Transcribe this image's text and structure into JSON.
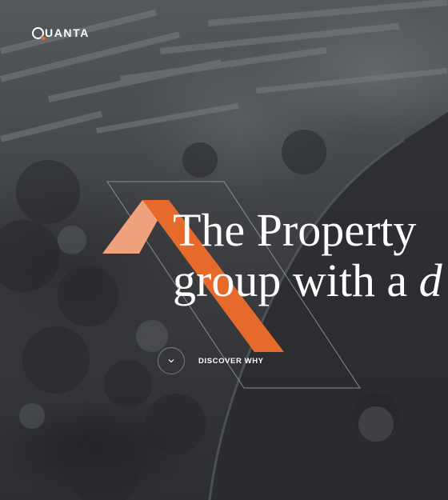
{
  "brand": {
    "logo_text": "UANTA",
    "logo_letter": "Q"
  },
  "hero": {
    "headline_line1": "The Property",
    "headline_line2_plain": "group with a ",
    "headline_line2_emphasis": "d",
    "cta_label": "DISCOVER WHY",
    "cta_icon": "chevron-down-icon"
  },
  "colors": {
    "accent_dark": "#e66a2c",
    "accent_light": "#efa07c",
    "text": "#ffffff"
  }
}
